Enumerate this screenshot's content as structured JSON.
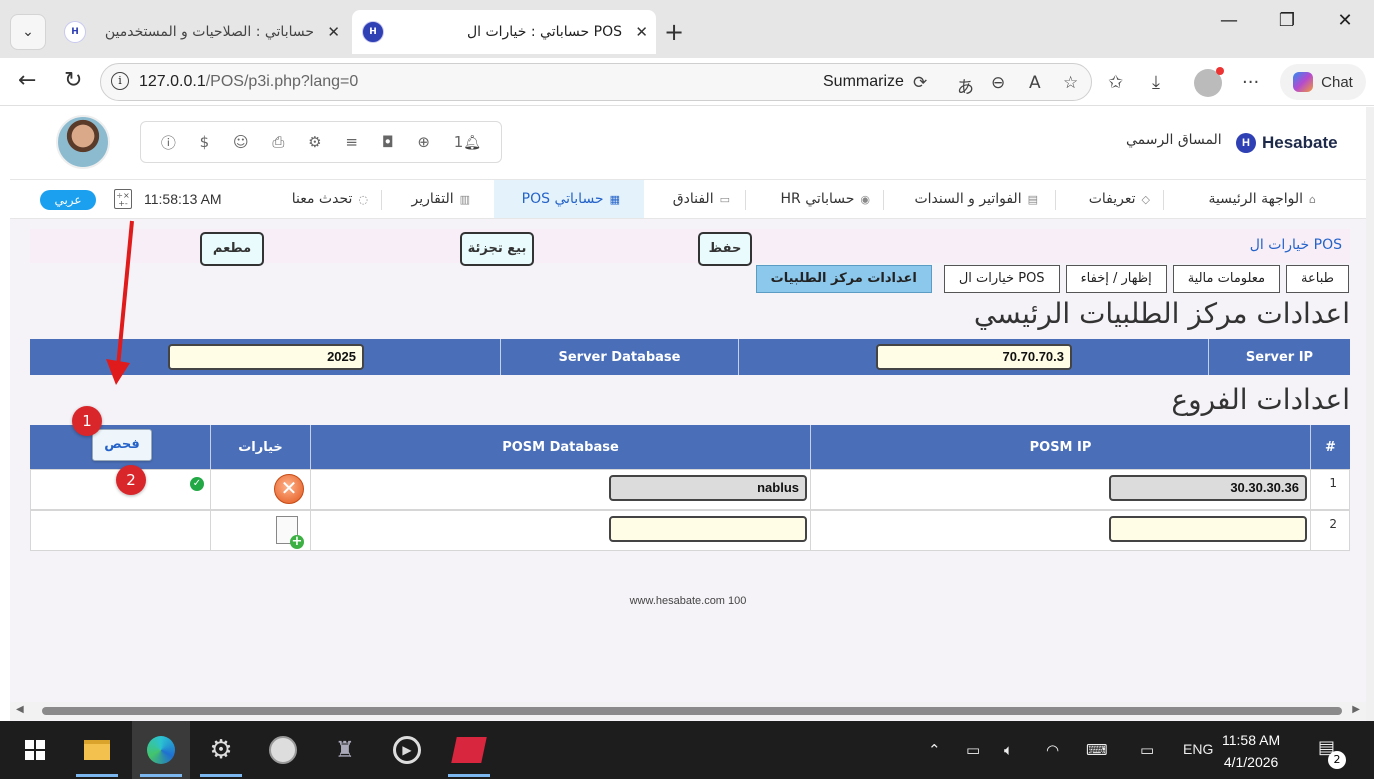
{
  "browser": {
    "tabs": [
      {
        "title": "حساباتي : الصلاحيات و المستخدمين",
        "active": false
      },
      {
        "title": "حساباتي : خيارات ال POS",
        "active": true
      }
    ],
    "url_host": "127.0.0.1",
    "url_path": "/POS/p3i.php?lang=0",
    "summarize_label": "Summarize",
    "chat_label": "Chat"
  },
  "header": {
    "company_name": "المساق الرسمي",
    "brand": "Hesabate",
    "brand_logo": "H",
    "notification_count": "1"
  },
  "menu": {
    "items": [
      {
        "label": "الواجهة الرئيسية",
        "icon": "home-icon"
      },
      {
        "label": "تعريفات",
        "icon": "layers-icon"
      },
      {
        "label": "الفواتير و السندات",
        "icon": "invoice-icon"
      },
      {
        "label": "حساباتي HR",
        "icon": "hr-icon"
      },
      {
        "label": "الفنادق",
        "icon": "hotel-icon"
      },
      {
        "label": "حساباتي POS",
        "icon": "pos-icon",
        "active": true
      },
      {
        "label": "التقارير",
        "icon": "reports-icon"
      },
      {
        "label": "تحدث معنا",
        "icon": "chat-icon"
      }
    ],
    "clock": "11:58:13 AM",
    "lang_button": "عربي"
  },
  "content": {
    "breadcrumb": "خيارات ال POS",
    "buttons": {
      "save": "حفظ",
      "retail": "بيع تجزئة",
      "restaurant": "مطعم"
    },
    "subtabs": [
      {
        "label": "طباعة"
      },
      {
        "label": "معلومات مالية"
      },
      {
        "label": "إظهار / إخفاء"
      },
      {
        "label": "خيارات ال POS"
      },
      {
        "label": "اعدادات مركز الطلبيات",
        "active": true
      }
    ],
    "main_section": {
      "title": "اعدادات مركز الطلبيات الرئيسي",
      "server_ip_label": "Server IP",
      "server_ip_value": "70.70.70.3",
      "server_db_label": "Server Database",
      "server_db_value": "2025"
    },
    "branches_section": {
      "title": "اعدادات الفروع",
      "columns": {
        "num": "#",
        "ip": "POSM IP",
        "db": "POSM Database",
        "options": "خيارات"
      },
      "check_button": "فحص",
      "rows": [
        {
          "num": "1",
          "ip": "30.30.30.36",
          "db": "nablus"
        },
        {
          "num": "2",
          "ip": "",
          "db": ""
        }
      ]
    },
    "annotations": [
      "1",
      "2"
    ]
  },
  "footer": "www.hesabate.com 100",
  "taskbar": {
    "language": "ENG",
    "time": "11:58 AM",
    "date": "4/1/2026",
    "notifications": "2"
  }
}
